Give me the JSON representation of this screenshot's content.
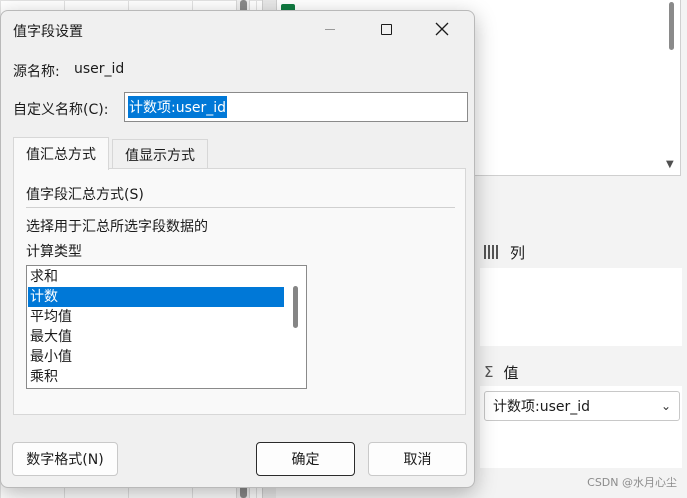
{
  "dialog": {
    "title": "值字段设置",
    "source_label": "源名称:",
    "source_value": "user_id",
    "custom_name_label": "自定义名称(C):",
    "custom_name_value": "计数项:user_id",
    "tabs": [
      {
        "label": "值汇总方式",
        "active": true
      },
      {
        "label": "值显示方式",
        "active": false
      }
    ],
    "summarize_title": "值字段汇总方式(S)",
    "description": "选择用于汇总所选字段数据的",
    "calc_type_label": "计算类型",
    "calc_types": [
      {
        "label": "求和",
        "selected": false
      },
      {
        "label": "计数",
        "selected": true
      },
      {
        "label": "平均值",
        "selected": false
      },
      {
        "label": "最大值",
        "selected": false
      },
      {
        "label": "最小值",
        "selected": false
      },
      {
        "label": "乘积",
        "selected": false
      }
    ],
    "buttons": {
      "number_format": "数字格式(N)",
      "ok": "确定",
      "cancel": "取消"
    }
  },
  "pivot_panel": {
    "columns_label": "列",
    "values_label": "值",
    "values_field": "计数项:user_id"
  },
  "watermark": "CSDN @水月心尘",
  "colors": {
    "accent": "#0078d7",
    "excel_green": "#107c41"
  }
}
